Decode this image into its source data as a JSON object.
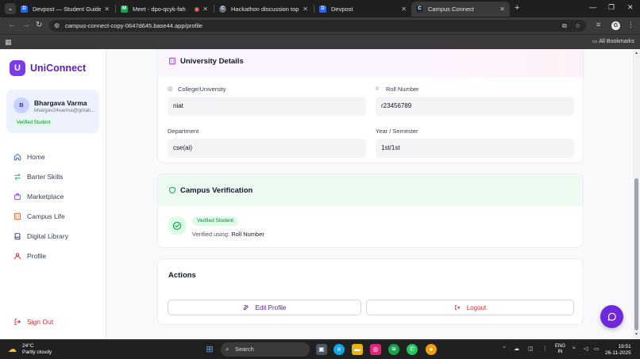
{
  "browser": {
    "tabs": [
      {
        "title": "Devpost — Student Guide for I",
        "fav_color": "#2563eb",
        "fav_text": "D"
      },
      {
        "title": "Meet - dpo-qcyk-fah",
        "fav_color": "#16a34a",
        "fav_text": "M"
      },
      {
        "title": "Hackathon discussion topics",
        "fav_color": "#9ca3af",
        "fav_text": "C"
      },
      {
        "title": "Devpost",
        "fav_color": "#2563eb",
        "fav_text": "D"
      },
      {
        "title": "Campus Connect",
        "fav_color": "#1e293b",
        "fav_text": "C"
      }
    ],
    "url": "campus-connect-copy-0647d645.base44.app/profile",
    "all_bookmarks": "All Bookmarks",
    "profile_initial": "G"
  },
  "brand": {
    "logo_letter": "U",
    "name": "UniConnect",
    "color": "#7c3aed"
  },
  "user": {
    "initial": "B",
    "name": "Bhargava Varma",
    "email": "bhargav24varma@gmail...",
    "badge": "Verified Student"
  },
  "sidebar": {
    "items": [
      {
        "label": "Home",
        "icon": "home-icon",
        "color": "#2563eb"
      },
      {
        "label": "Barter Skills",
        "icon": "swap-icon",
        "color": "#16a34a"
      },
      {
        "label": "Marketplace",
        "icon": "shopping-bag-icon",
        "color": "#9333ea"
      },
      {
        "label": "Campus Life",
        "icon": "building-icon",
        "color": "#ea580c"
      },
      {
        "label": "Digital Library",
        "icon": "book-icon",
        "color": "#1e3a8a"
      },
      {
        "label": "Profile",
        "icon": "user-icon",
        "color": "#dc2626"
      }
    ],
    "sign_out": "Sign Out"
  },
  "university": {
    "title": "University Details",
    "fields": [
      {
        "label": "College/University",
        "value": "niat"
      },
      {
        "label": "Roll Number",
        "value": "r23456789"
      },
      {
        "label": "Department",
        "value": "cse(ai)"
      },
      {
        "label": "Year / Semester",
        "value": "1st/1st"
      }
    ]
  },
  "verification": {
    "title": "Campus Verification",
    "badge": "Verified Student",
    "using_label": "Verified using:",
    "using_value": "Roll Number"
  },
  "actions": {
    "title": "Actions",
    "edit_label": "Edit Profile",
    "logout_label": "Logout"
  },
  "taskbar": {
    "temperature": "24°C",
    "weather": "Partly cloudy",
    "search": "Search",
    "lang_top": "ENG",
    "lang_bottom": "IN",
    "time": "19:51",
    "date": "26-11-2025"
  }
}
